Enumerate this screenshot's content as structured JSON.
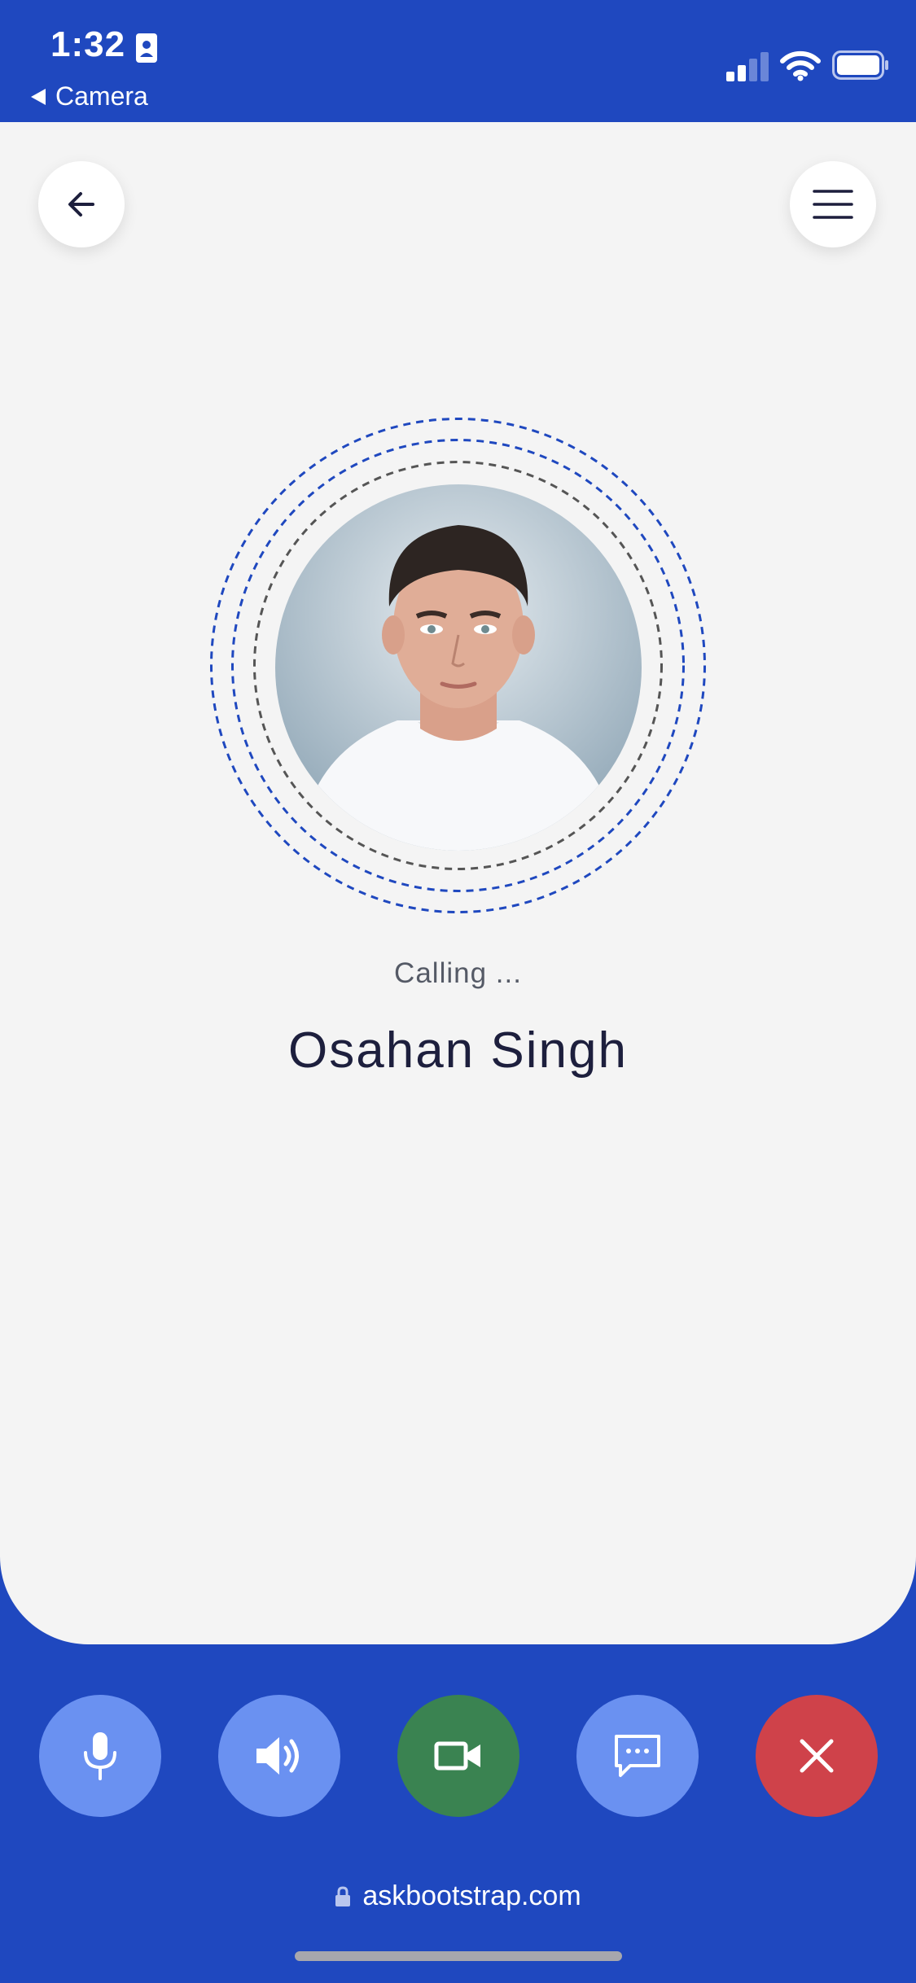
{
  "status_bar": {
    "time": "1:32",
    "back_app": "Camera"
  },
  "header": {
    "back_icon": "arrow-left-icon",
    "menu_icon": "hamburger-menu-icon"
  },
  "call": {
    "status": "Calling ...",
    "contact_name": "Osahan Singh"
  },
  "controls": [
    {
      "icon": "microphone-icon",
      "color": "#6a91f1"
    },
    {
      "icon": "speaker-icon",
      "color": "#6a91f1"
    },
    {
      "icon": "video-camera-icon",
      "color": "#3a8351"
    },
    {
      "icon": "message-icon",
      "color": "#6a91f1"
    },
    {
      "icon": "close-icon",
      "color": "#cf424a"
    }
  ],
  "browser": {
    "url": "askbootstrap.com"
  },
  "colors": {
    "primary": "#1f48bf",
    "background": "#f4f4f4",
    "ring_blue": "#1f48bf",
    "ring_gray": "#555555"
  }
}
